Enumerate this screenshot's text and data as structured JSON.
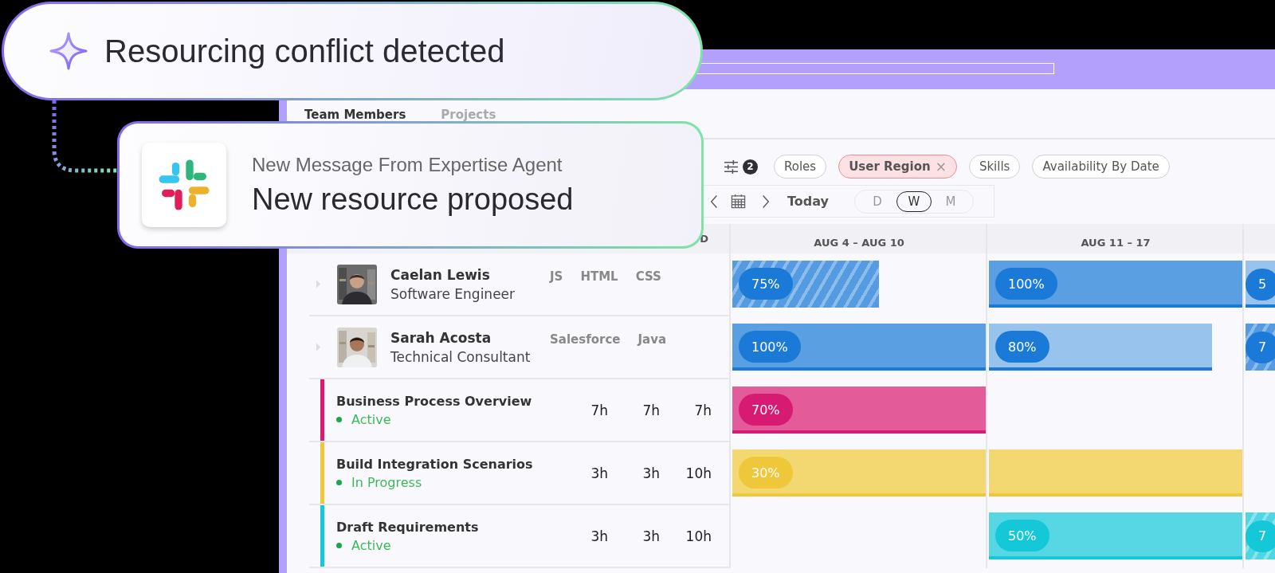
{
  "alert": {
    "title": "Resourcing conflict detected"
  },
  "message": {
    "subtitle": "New Message From Expertise Agent",
    "title": "New resource proposed"
  },
  "tabs": [
    {
      "label": "Team Members",
      "selected": true
    },
    {
      "label": "Projects",
      "selected": false
    }
  ],
  "filters": {
    "count": "2",
    "chips": [
      {
        "label": "Roles",
        "selected": false
      },
      {
        "label": "User Region",
        "selected": true,
        "remove": "×"
      },
      {
        "label": "Skills",
        "selected": false
      },
      {
        "label": "Availability By Date",
        "selected": false
      }
    ]
  },
  "navigation": {
    "today": "Today",
    "views": [
      {
        "label": "D",
        "selected": false
      },
      {
        "label": "W",
        "selected": true
      },
      {
        "label": "M",
        "selected": false
      }
    ]
  },
  "columns": [
    "D",
    "AUG 4 – AUG 10",
    "AUG 11 – 17"
  ],
  "rows": [
    {
      "kind": "person",
      "name": "Caelan Lewis",
      "role": "Software Engineer",
      "avatar": {
        "kind": "picture"
      },
      "skills": [
        "JS",
        "HTML",
        "CSS"
      ],
      "cells": [
        {
          "kind": "hatched",
          "color": "#1b7ad8",
          "level": 0.58,
          "label": "75%"
        },
        {
          "kind": "solid",
          "color": "#1b7ad8",
          "level": 1,
          "label": "100%"
        },
        {
          "kind": "light",
          "color": "#1b7ad8",
          "label": "5"
        }
      ]
    },
    {
      "kind": "person",
      "name": "Sarah Acosta",
      "role": "Technical Consultant",
      "avatar": {
        "kind": "picture"
      },
      "skills": [
        "Salesforce",
        "Java"
      ],
      "cells": [
        {
          "kind": "solid",
          "color": "#1b7ad8",
          "level": 1,
          "label": "100%"
        },
        {
          "kind": "light",
          "color": "#1b7ad8",
          "level": 0.88,
          "label": "80%"
        },
        {
          "kind": "hatched",
          "color": "#1b7ad8",
          "label": "7"
        }
      ]
    },
    {
      "kind": "task",
      "name": "Business Process Overview",
      "status": "Active",
      "color": "#d81b72",
      "hours": [
        "7h",
        "7h",
        "7h"
      ],
      "cells": [
        {
          "kind": "solid",
          "color": "#d81b72",
          "level": 1,
          "label": "70%"
        },
        {
          "kind": "empty"
        },
        {
          "kind": "empty"
        }
      ]
    },
    {
      "kind": "task",
      "name": "Build Integration Scenarios",
      "status": "In Progress",
      "color": "#eec83a",
      "hours": [
        "3h",
        "3h",
        "10h"
      ],
      "cells": [
        {
          "kind": "solid",
          "color": "#eec83a",
          "level": 1,
          "label": "30%"
        },
        {
          "kind": "solid",
          "color": "#eec83a",
          "level": 1
        },
        {
          "kind": "empty"
        }
      ]
    },
    {
      "kind": "task",
      "name": "Draft Requirements",
      "status": "Active",
      "color": "#14c8d8",
      "hours": [
        "3h",
        "3h",
        "10h"
      ],
      "cells": [
        {
          "kind": "empty"
        },
        {
          "kind": "solid",
          "color": "#14c8d8",
          "level": 1,
          "label": "50%"
        },
        {
          "kind": "hatched",
          "color": "#14c8d8",
          "label": "7"
        }
      ]
    }
  ]
}
